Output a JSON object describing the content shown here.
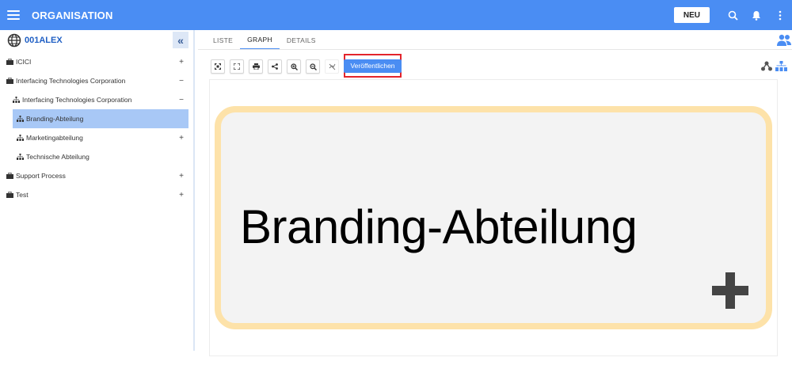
{
  "topbar": {
    "title": "ORGANISATION",
    "new_label": "NEU"
  },
  "sidebar": {
    "title": "001ALEX",
    "collapse_glyph": "«",
    "items": [
      {
        "label": "ICICI",
        "toggle": "+",
        "icon": "briefcase-icon"
      },
      {
        "label": "Interfacing Technologies Corporation",
        "toggle": "−",
        "icon": "briefcase-icon"
      },
      {
        "label": "Interfacing Technologies Corporation",
        "toggle": "−",
        "icon": "org-chart-icon"
      },
      {
        "label": "Branding-Abteilung",
        "toggle": "",
        "icon": "org-chart-icon",
        "selected": true
      },
      {
        "label": "Marketingabteilung",
        "toggle": "+",
        "icon": "org-chart-icon"
      },
      {
        "label": "Technische Abteilung",
        "toggle": "",
        "icon": "org-chart-icon"
      },
      {
        "label": "Support Process",
        "toggle": "+",
        "icon": "briefcase-icon"
      },
      {
        "label": "Test",
        "toggle": "+",
        "icon": "briefcase-icon"
      }
    ]
  },
  "tabs": [
    {
      "label": "LISTE"
    },
    {
      "label": "GRAPH",
      "active": true
    },
    {
      "label": "DETAILS"
    }
  ],
  "toolbar": {
    "buttons": [
      "fit-icon",
      "fullscreen-icon",
      "print-icon",
      "share-icon",
      "zoom-in-icon",
      "zoom-out-icon",
      "hide-icon"
    ],
    "publish_label": "Veröffentlichen"
  },
  "graph": {
    "node_label": "Branding-Abteilung"
  },
  "colors": {
    "accent": "#4a8df3",
    "highlight_border": "#e3242b",
    "node_border": "#fde2a9",
    "selected": "#a8c8f6"
  }
}
